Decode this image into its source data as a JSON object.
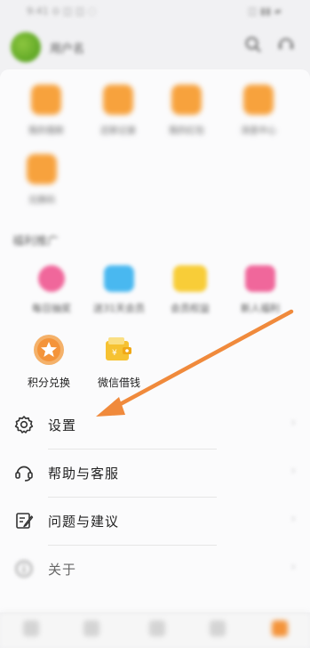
{
  "status_bar": {
    "left": "9:41 ⊙ ◫ ◫ ◌",
    "right": "◫ ▮▮ ▰"
  },
  "header": {
    "username": "用户名"
  },
  "services": [
    {
      "label": "我的借款",
      "color": "#f7a23d"
    },
    {
      "label": "还款记录",
      "color": "#f7a23d"
    },
    {
      "label": "我的红包",
      "color": "#f7a23d"
    },
    {
      "label": "消息中心",
      "color": "#f7a23d"
    },
    {
      "label": "兑换码",
      "color": "#f7a23d"
    }
  ],
  "section": {
    "title": "福利推广"
  },
  "promos": [
    {
      "label": "每日抽奖",
      "color": "#f0679b"
    },
    {
      "label": "送31天会员",
      "color": "#49b8f0"
    },
    {
      "label": "会员权益",
      "color": "#f8cd38"
    },
    {
      "label": "新人福利",
      "color": "#f0679b"
    }
  ],
  "sharp_promos": [
    {
      "label": "积分兑换",
      "color": "#f4943a"
    },
    {
      "label": "微信借钱",
      "color": "#f6c232"
    }
  ],
  "menu": [
    {
      "label": "设置",
      "icon": "gear-icon"
    },
    {
      "label": "帮助与客服",
      "icon": "headset-icon"
    },
    {
      "label": "问题与建议",
      "icon": "edit-note-icon"
    },
    {
      "label": "关于",
      "icon": "info-icon"
    }
  ],
  "annotation": {
    "arrow_color": "#f08a3c"
  },
  "colors": {
    "accent": "#f4943a",
    "background": "#f1f1f3"
  }
}
